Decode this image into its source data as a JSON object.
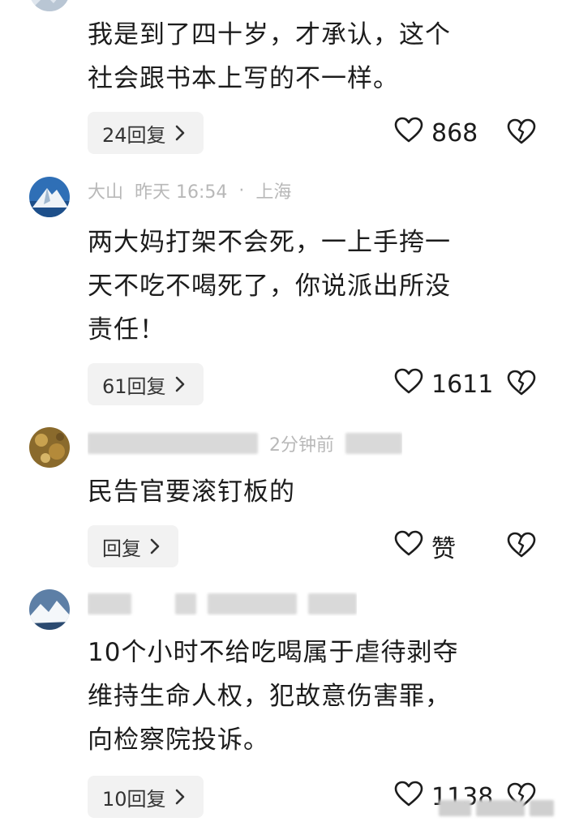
{
  "comments": [
    {
      "author": "",
      "time": "",
      "location": "",
      "text": "我是到了四十岁，才承认，这个\n社会跟书本上写的不一样。",
      "reply_label": "24回复",
      "likes": "868"
    },
    {
      "author": "大山",
      "time": "昨天 16:54",
      "location": "上海",
      "text": "两大妈打架不会死，一上手挎一\n天不吃不喝死了，你说派出所没\n责任！",
      "reply_label": "61回复",
      "likes": "1611"
    },
    {
      "author": "",
      "time": "2分钟前",
      "location": "",
      "text": "民告官要滚钉板的",
      "reply_label": "回复",
      "likes": "赞"
    },
    {
      "author": "",
      "time": "",
      "location": "",
      "text": "10个小时不给吃喝属于虐待剥夺\n维持生命人权，犯故意伤害罪，\n向检察院投诉。",
      "reply_label": "10回复",
      "likes": "1138"
    }
  ],
  "icons": {
    "like": "heart-outline",
    "dislike": "broken-heart-outline",
    "reply_chevron": "chevron-right"
  },
  "colors": {
    "text": "#1c1c1c",
    "meta": "#b8b8b8",
    "reply_bg": "#f2f2f2"
  }
}
